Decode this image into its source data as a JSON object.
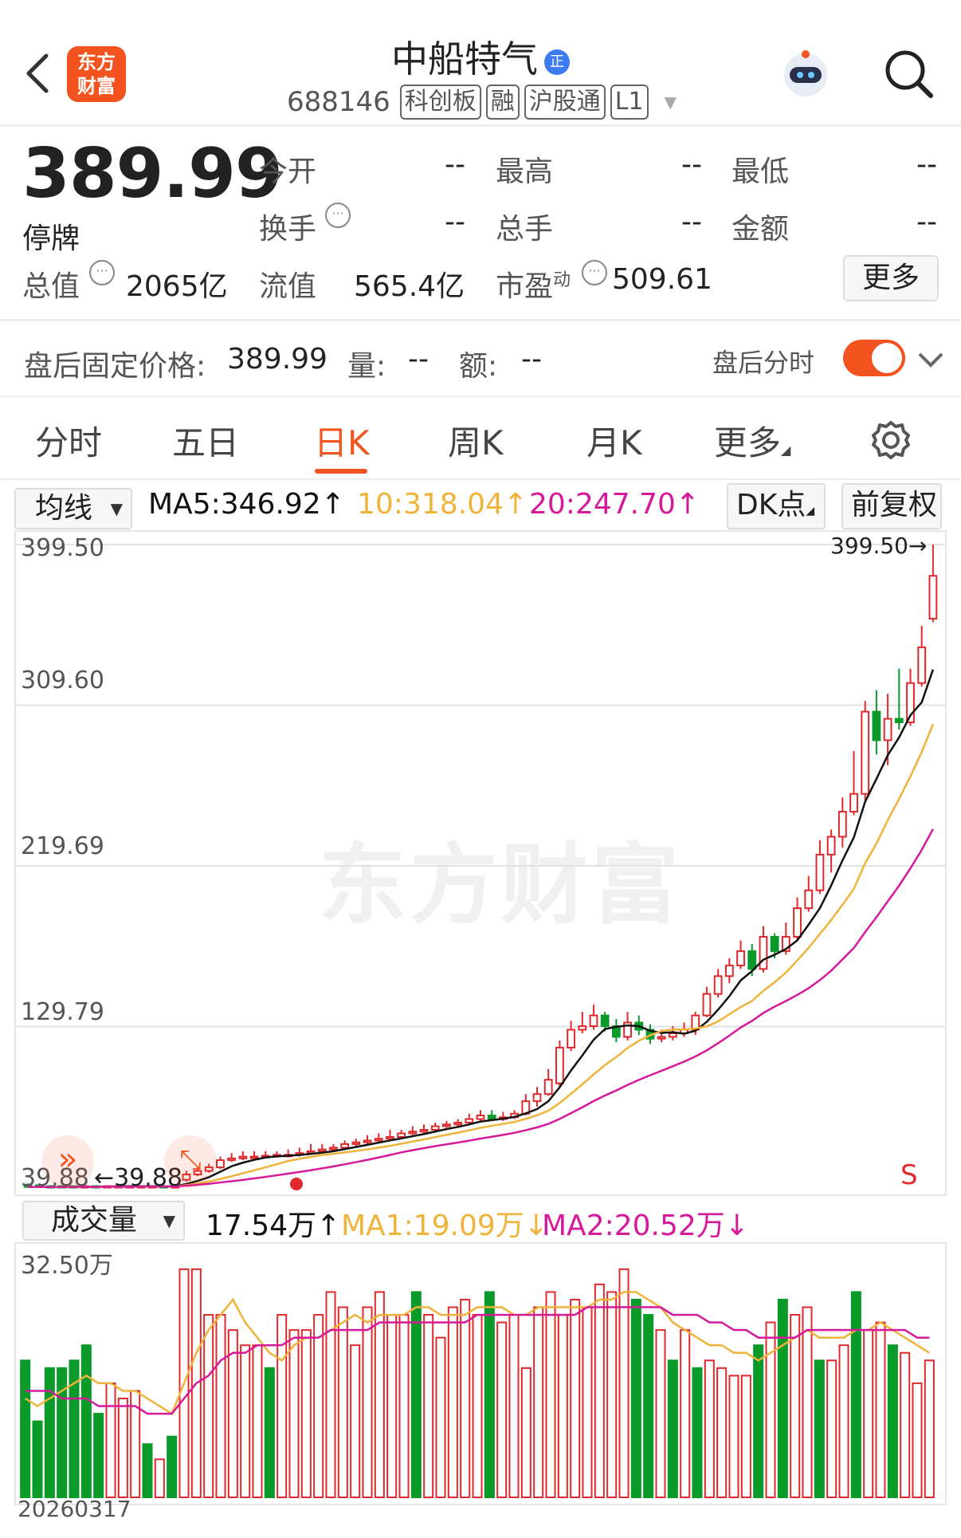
{
  "header": {
    "logo_text": "东方财富",
    "title": "中船特气",
    "badge": "正",
    "code": "688146",
    "tags": [
      "科创板",
      "融",
      "沪股通",
      "L1"
    ]
  },
  "quote": {
    "price": "389.99",
    "status": "停牌",
    "fields": [
      {
        "label": "今开",
        "value": "--"
      },
      {
        "label": "最高",
        "value": "--"
      },
      {
        "label": "最低",
        "value": "--"
      },
      {
        "label": "换手",
        "value": "--"
      },
      {
        "label": "总手",
        "value": "--"
      },
      {
        "label": "金额",
        "value": "--"
      }
    ],
    "total_cap_label": "总值",
    "total_cap": "2065亿",
    "float_cap_label": "流值",
    "float_cap": "565.4亿",
    "pe_label": "市盈",
    "pe_sup": "动",
    "pe": "509.61",
    "more": "更多"
  },
  "after_hours": {
    "label": "盘后固定价格:",
    "price": "389.99",
    "vol_label": "量:",
    "vol": "--",
    "amt_label": "额:",
    "amt": "--",
    "toggle_label": "盘后分时",
    "toggle_on": true
  },
  "tabs": [
    "分时",
    "五日",
    "日K",
    "周K",
    "月K",
    "更多"
  ],
  "active_tab": "日K",
  "ma_bar": {
    "select": "均线",
    "ma5": "MA5:346.92",
    "ma10": "10:318.04",
    "ma20": "20:247.70",
    "arrow": "↑",
    "dk": "DK点",
    "adjust": "前复权"
  },
  "colors": {
    "up": "#e0292c",
    "down": "#0a9a2a",
    "ma5": "#111111",
    "ma10": "#f0b33a",
    "ma20": "#d6199b",
    "accent": "#f3541f"
  },
  "vol_bar": {
    "select": "成交量",
    "vol": "17.54万",
    "ma1": "MA1:19.09万",
    "ma2": "MA2:20.52万",
    "up_arrow": "↑",
    "down_arrow": "↓"
  },
  "chart_data": {
    "type": "candlestick",
    "y_ticks": [
      "399.50",
      "309.60",
      "219.69",
      "129.79",
      "39.88"
    ],
    "ylim": [
      39.88,
      399.5
    ],
    "max_marker": "399.50→",
    "min_marker": "←39.88",
    "signal": "S",
    "candles": [
      [
        41,
        40,
        42,
        39.9
      ],
      [
        41,
        40,
        42,
        39.9
      ],
      [
        40.5,
        40,
        41,
        39.9
      ],
      [
        40.5,
        40,
        41,
        39.9
      ],
      [
        40.5,
        40,
        41,
        39.9
      ],
      [
        40,
        40.5,
        41,
        39.9
      ],
      [
        40.5,
        40,
        41,
        39.9
      ],
      [
        40,
        40.5,
        41,
        39.9
      ],
      [
        40,
        40.5,
        41,
        39.9
      ],
      [
        40,
        40.5,
        41,
        39.9
      ],
      [
        40,
        40.5,
        41,
        39.9
      ],
      [
        40,
        40.5,
        41,
        39.9
      ],
      [
        40.5,
        40,
        41,
        39.9
      ],
      [
        40,
        40.5,
        41,
        39.9
      ],
      [
        44,
        47,
        49,
        43
      ],
      [
        47,
        49,
        51,
        46
      ],
      [
        49,
        51,
        53,
        48
      ],
      [
        51,
        55,
        57,
        50
      ],
      [
        55,
        56,
        59,
        54
      ],
      [
        56,
        57,
        60,
        55
      ],
      [
        57,
        57,
        60,
        56
      ],
      [
        57,
        57.5,
        60,
        56
      ],
      [
        57.5,
        58,
        60,
        56.5
      ],
      [
        58,
        58,
        61,
        56.5
      ],
      [
        58,
        59,
        62,
        57
      ],
      [
        59,
        60,
        64,
        58
      ],
      [
        60,
        61,
        64,
        59
      ],
      [
        61,
        62,
        64,
        60
      ],
      [
        62,
        64,
        66,
        61
      ],
      [
        64,
        65,
        67,
        63
      ],
      [
        65,
        66,
        69,
        64
      ],
      [
        66,
        67,
        70,
        65
      ],
      [
        67,
        68,
        72,
        66
      ],
      [
        68,
        70,
        72,
        67
      ],
      [
        70,
        71,
        74,
        69
      ],
      [
        71,
        72,
        75,
        70
      ],
      [
        72,
        74,
        76,
        71
      ],
      [
        74,
        75,
        77,
        73
      ],
      [
        75,
        76,
        78,
        74
      ],
      [
        76,
        78,
        81,
        75
      ],
      [
        78,
        80,
        83,
        77
      ],
      [
        80,
        78,
        83,
        77
      ],
      [
        78,
        79,
        82,
        77
      ],
      [
        79,
        81,
        83,
        78
      ],
      [
        81,
        88,
        92,
        80
      ],
      [
        88,
        92,
        96,
        85
      ],
      [
        92,
        100,
        106,
        91
      ],
      [
        98,
        118,
        122,
        96
      ],
      [
        118,
        128,
        133,
        116
      ],
      [
        128,
        130,
        138,
        126
      ],
      [
        130,
        136,
        142,
        128
      ],
      [
        136,
        130,
        138,
        127
      ],
      [
        130,
        124,
        134,
        121
      ],
      [
        124,
        132,
        138,
        122
      ],
      [
        132,
        128,
        136,
        125
      ],
      [
        128,
        123,
        131,
        120
      ],
      [
        123,
        124,
        128,
        121
      ],
      [
        124,
        126,
        130,
        122
      ],
      [
        126,
        128,
        132,
        124
      ],
      [
        128,
        136,
        138,
        125
      ],
      [
        136,
        148,
        152,
        135
      ],
      [
        148,
        158,
        162,
        146
      ],
      [
        158,
        164,
        168,
        154
      ],
      [
        164,
        172,
        178,
        162
      ],
      [
        172,
        162,
        176,
        158
      ],
      [
        162,
        180,
        186,
        160
      ],
      [
        180,
        172,
        182,
        168
      ],
      [
        172,
        180,
        188,
        170
      ],
      [
        180,
        196,
        202,
        178
      ],
      [
        196,
        206,
        214,
        194
      ],
      [
        206,
        226,
        234,
        204
      ],
      [
        226,
        236,
        240,
        216
      ],
      [
        236,
        250,
        258,
        230
      ],
      [
        250,
        260,
        284,
        248
      ],
      [
        260,
        306,
        312,
        256
      ],
      [
        306,
        290,
        318,
        282
      ],
      [
        290,
        302,
        316,
        276
      ],
      [
        302,
        300,
        330,
        296
      ],
      [
        300,
        322,
        330,
        298
      ],
      [
        322,
        342,
        354,
        320
      ],
      [
        358,
        382,
        399.5,
        356
      ]
    ],
    "volume_max": "32.50万",
    "date_label": "20260317",
    "volumes": [
      [
        18,
        -1
      ],
      [
        10,
        -1
      ],
      [
        17,
        -1
      ],
      [
        17,
        -1
      ],
      [
        18,
        -1
      ],
      [
        20,
        -1
      ],
      [
        11,
        -1
      ],
      [
        15,
        1
      ],
      [
        13,
        1
      ],
      [
        14,
        1
      ],
      [
        7,
        -1
      ],
      [
        5,
        1
      ],
      [
        8,
        -1
      ],
      [
        30,
        1
      ],
      [
        30,
        1
      ],
      [
        24,
        1
      ],
      [
        24,
        1
      ],
      [
        22,
        1
      ],
      [
        20,
        1
      ],
      [
        20,
        1
      ],
      [
        17,
        -1
      ],
      [
        24,
        1
      ],
      [
        22,
        1
      ],
      [
        22,
        1
      ],
      [
        24,
        1
      ],
      [
        27,
        1
      ],
      [
        25,
        1
      ],
      [
        20,
        1
      ],
      [
        25,
        1
      ],
      [
        27,
        1
      ],
      [
        24,
        1
      ],
      [
        24,
        1
      ],
      [
        27,
        -1
      ],
      [
        24,
        1
      ],
      [
        21,
        1
      ],
      [
        25,
        1
      ],
      [
        26,
        1
      ],
      [
        24,
        1
      ],
      [
        27,
        -1
      ],
      [
        23,
        1
      ],
      [
        24,
        1
      ],
      [
        17,
        1
      ],
      [
        25,
        1
      ],
      [
        27,
        1
      ],
      [
        24,
        1
      ],
      [
        26,
        1
      ],
      [
        25,
        1
      ],
      [
        28,
        1
      ],
      [
        27,
        1
      ],
      [
        30,
        1
      ],
      [
        26,
        -1
      ],
      [
        24,
        -1
      ],
      [
        22,
        1
      ],
      [
        18,
        -1
      ],
      [
        22,
        1
      ],
      [
        17,
        -1
      ],
      [
        18,
        1
      ],
      [
        17,
        1
      ],
      [
        16,
        1
      ],
      [
        16,
        1
      ],
      [
        20,
        -1
      ],
      [
        23,
        1
      ],
      [
        26,
        -1
      ],
      [
        24,
        1
      ],
      [
        25,
        1
      ],
      [
        18,
        -1
      ],
      [
        18,
        1
      ],
      [
        20,
        1
      ],
      [
        27,
        -1
      ],
      [
        22,
        1
      ],
      [
        23,
        1
      ],
      [
        20,
        -1
      ],
      [
        19,
        1
      ],
      [
        15,
        1
      ],
      [
        18,
        1
      ]
    ],
    "ma1_line": [
      13,
      12,
      13,
      14,
      15,
      16,
      15,
      15,
      14,
      14,
      13,
      12,
      11,
      15,
      19,
      22,
      24,
      26,
      23,
      21,
      19,
      18,
      20,
      21,
      21,
      22,
      23,
      24,
      23,
      24,
      24,
      24,
      25,
      25,
      24,
      24,
      24,
      25,
      25,
      25,
      24,
      24,
      25,
      25,
      25,
      25,
      25,
      26,
      26,
      27,
      27,
      26,
      25,
      23,
      22,
      21,
      20,
      20,
      19,
      19,
      18,
      19,
      20,
      21,
      22,
      21,
      21,
      21,
      22,
      22,
      23,
      22,
      21,
      20,
      19
    ],
    "ma2_line": [
      14,
      14,
      14,
      13,
      13,
      13,
      12,
      12,
      12,
      12,
      11,
      11,
      11,
      13,
      15,
      16,
      18,
      19,
      19,
      20,
      20,
      20,
      21,
      21,
      21,
      22,
      22,
      22,
      22,
      23,
      23,
      23,
      23,
      23,
      23,
      23,
      23,
      24,
      24,
      24,
      24,
      24,
      24,
      24,
      24,
      24,
      25,
      25,
      25,
      25,
      25,
      25,
      25,
      24,
      24,
      24,
      23,
      23,
      22,
      22,
      21,
      21,
      21,
      21,
      22,
      22,
      22,
      22,
      22,
      22,
      22,
      22,
      22,
      21,
      21
    ]
  }
}
